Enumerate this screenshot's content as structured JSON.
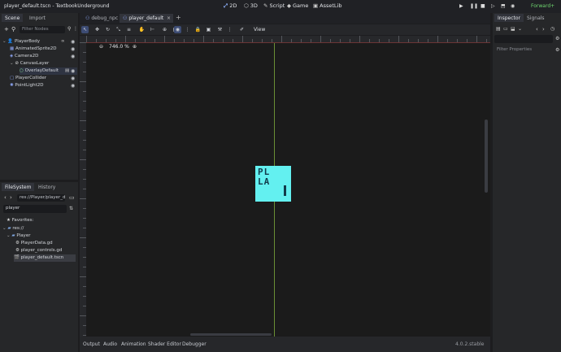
{
  "window": {
    "title": "player_default.tscn - TextbookUnderground"
  },
  "workspaces": [
    {
      "icon": "2d-icon",
      "label": "2D"
    },
    {
      "icon": "3d-icon",
      "label": "3D"
    },
    {
      "icon": "script-icon",
      "label": "Script"
    },
    {
      "icon": "game-icon",
      "label": "Game"
    },
    {
      "icon": "assetlib-icon",
      "label": "AssetLib"
    }
  ],
  "renderer": "Forward+",
  "scene_panel": {
    "tabs": [
      "Scene",
      "Import"
    ],
    "filter_placeholder": "Filter Nodes",
    "nodes": [
      {
        "name": "PlayerBody",
        "icon": "character-body-icon",
        "color": "#8da5f3",
        "depth": 0
      },
      {
        "name": "AnimatedSprite2D",
        "icon": "animated-sprite-icon",
        "color": "#8da5f3",
        "depth": 1
      },
      {
        "name": "Camera2D",
        "icon": "camera-icon",
        "color": "#8da5f3",
        "depth": 1
      },
      {
        "name": "CanvasLayer",
        "icon": "canvas-layer-icon",
        "color": "#e0e0e0",
        "depth": 1
      },
      {
        "name": "OverlayDefault",
        "icon": "circle-icon",
        "color": "#8eef97",
        "depth": 2
      },
      {
        "name": "PlayerCollider",
        "icon": "collision-shape-icon",
        "color": "#8da5f3",
        "depth": 1
      },
      {
        "name": "PointLight2D",
        "icon": "light-icon",
        "color": "#8da5f3",
        "depth": 1
      }
    ]
  },
  "editor_tabs": [
    {
      "label": "debug_npc",
      "active": false
    },
    {
      "label": "player_default",
      "active": true
    }
  ],
  "toolbar": {
    "view_label": "View"
  },
  "viewport": {
    "zoom": "746.0 %",
    "sprite_text_top": "PL",
    "sprite_text_bottom": "LA"
  },
  "filesystem": {
    "tabs": [
      "FileSystem",
      "History"
    ],
    "path": "res://Player/player_d",
    "search": "player",
    "favorites_label": "Favorites:",
    "root_label": "res://",
    "folder_label": "Player",
    "files": [
      "PlayerData.gd",
      "player_controls.gd",
      "player_default.tscn"
    ]
  },
  "bottom_tabs": [
    "Output",
    "Audio",
    "Animation",
    "Shader Editor",
    "Debugger"
  ],
  "version": "4.0.2.stable",
  "inspector": {
    "tabs": [
      "Inspector",
      "Signals"
    ],
    "filter_placeholder": "Filter Properties"
  }
}
